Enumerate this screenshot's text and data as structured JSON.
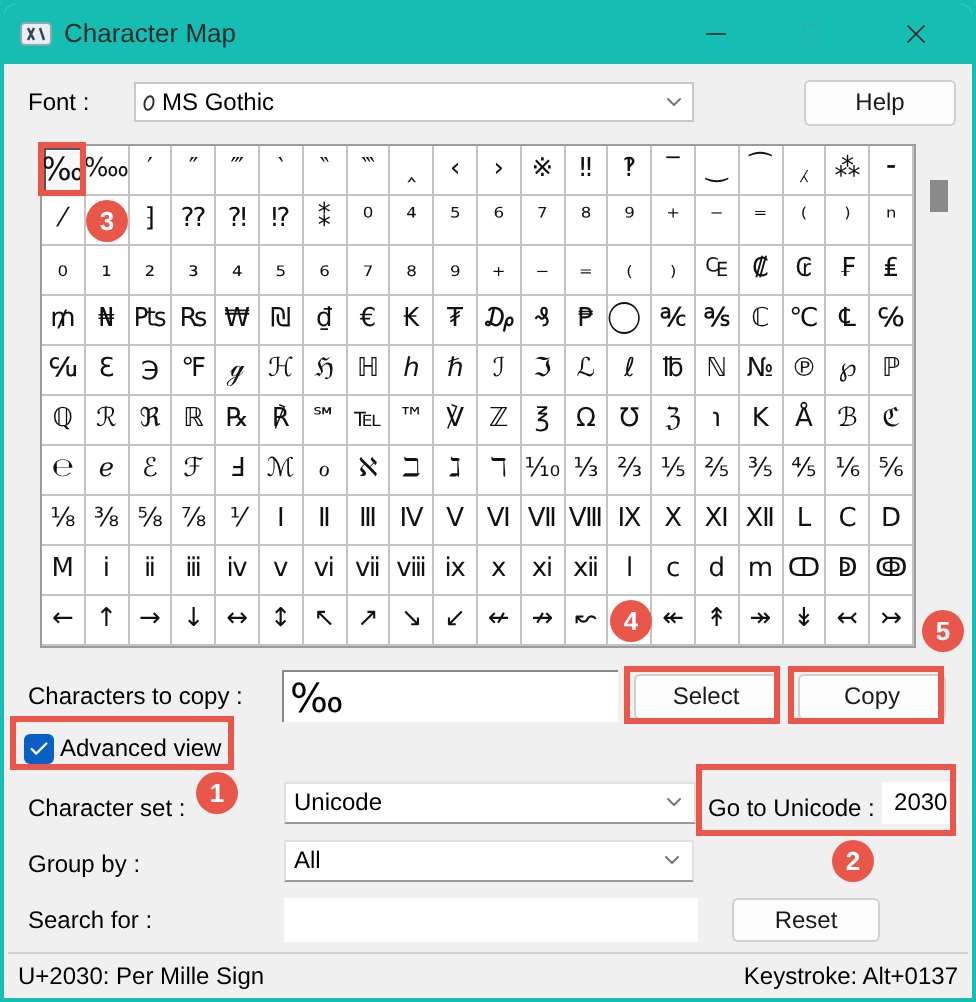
{
  "window": {
    "title": "Character Map"
  },
  "font": {
    "label": "Font :",
    "value": "MS Gothic"
  },
  "help_button": "Help",
  "grid": [
    {
      "cells": [
        {
          "char": "‰",
          "selected": true
        },
        {
          "char": "‱",
          "selected": false
        },
        {
          "char": "′",
          "selected": false
        },
        {
          "char": "″",
          "selected": false
        },
        {
          "char": "‴",
          "selected": false
        },
        {
          "char": "‵",
          "selected": false
        },
        {
          "char": "‶",
          "selected": false
        },
        {
          "char": "‷",
          "selected": false
        },
        {
          "char": "‸",
          "selected": false
        },
        {
          "char": "‹",
          "selected": false
        },
        {
          "char": "›",
          "selected": false
        },
        {
          "char": "※",
          "selected": false
        },
        {
          "char": "‼",
          "selected": false
        },
        {
          "char": "‽",
          "selected": false
        },
        {
          "char": "‾",
          "selected": false
        },
        {
          "char": "‿",
          "selected": false
        },
        {
          "char": "⁀",
          "selected": false
        },
        {
          "char": "⁁",
          "selected": false
        },
        {
          "char": "⁂",
          "selected": false
        },
        {
          "char": "⁃",
          "selected": false
        }
      ]
    },
    {
      "cells": [
        {
          "char": "⁄",
          "selected": false
        },
        {
          "kind": "covered"
        },
        {
          "char": "⁆",
          "selected": false
        },
        {
          "char": "⁇",
          "selected": false
        },
        {
          "char": "⁈",
          "selected": false
        },
        {
          "char": "⁉",
          "selected": false
        },
        {
          "char": "⁑",
          "selected": false
        },
        {
          "char": "⁰",
          "selected": false
        },
        {
          "char": "⁴",
          "selected": false
        },
        {
          "char": "⁵",
          "selected": false
        },
        {
          "char": "⁶",
          "selected": false
        },
        {
          "char": "⁷",
          "selected": false
        },
        {
          "char": "⁸",
          "selected": false
        },
        {
          "char": "⁹",
          "selected": false
        },
        {
          "char": "⁺",
          "selected": false
        },
        {
          "char": "⁻",
          "selected": false
        },
        {
          "char": "⁼",
          "selected": false
        },
        {
          "char": "⁽",
          "selected": false
        },
        {
          "char": "⁾",
          "selected": false
        },
        {
          "char": "ⁿ",
          "selected": false
        }
      ]
    },
    {
      "cells": [
        {
          "char": "₀",
          "selected": false
        },
        {
          "char": "₁",
          "selected": false
        },
        {
          "char": "₂",
          "selected": false
        },
        {
          "char": "₃",
          "selected": false
        },
        {
          "char": "₄",
          "selected": false
        },
        {
          "char": "₅",
          "selected": false
        },
        {
          "char": "₆",
          "selected": false
        },
        {
          "char": "₇",
          "selected": false
        },
        {
          "char": "₈",
          "selected": false
        },
        {
          "char": "₉",
          "selected": false
        },
        {
          "char": "₊",
          "selected": false
        },
        {
          "char": "₋",
          "selected": false
        },
        {
          "char": "₌",
          "selected": false
        },
        {
          "char": "₍",
          "selected": false
        },
        {
          "char": "₎",
          "selected": false
        },
        {
          "char": "₠",
          "selected": false
        },
        {
          "char": "₡",
          "selected": false
        },
        {
          "char": "₢",
          "selected": false
        },
        {
          "char": "₣",
          "selected": false
        },
        {
          "char": "₤",
          "selected": false
        }
      ]
    },
    {
      "cells": [
        {
          "char": "₥",
          "selected": false
        },
        {
          "char": "₦",
          "selected": false
        },
        {
          "char": "₧",
          "selected": false
        },
        {
          "char": "₨",
          "selected": false
        },
        {
          "char": "₩",
          "selected": false
        },
        {
          "char": "₪",
          "selected": false
        },
        {
          "char": "₫",
          "selected": false
        },
        {
          "char": "€",
          "selected": false
        },
        {
          "char": "₭",
          "selected": false
        },
        {
          "char": "₮",
          "selected": false
        },
        {
          "char": "₯",
          "selected": false
        },
        {
          "char": "₰",
          "selected": false
        },
        {
          "char": "₱",
          "selected": false
        },
        {
          "char": "⃝",
          "selected": false
        },
        {
          "char": "℀",
          "selected": false
        },
        {
          "char": "℁",
          "selected": false
        },
        {
          "char": "ℂ",
          "selected": false
        },
        {
          "char": "℃",
          "selected": false
        },
        {
          "char": "℄",
          "selected": false
        },
        {
          "char": "℅",
          "selected": false
        }
      ]
    },
    {
      "cells": [
        {
          "char": "℆",
          "selected": false
        },
        {
          "char": "ℇ",
          "selected": false
        },
        {
          "char": "℈",
          "selected": false
        },
        {
          "char": "℉",
          "selected": false
        },
        {
          "char": "ℊ",
          "selected": false
        },
        {
          "char": "ℋ",
          "selected": false
        },
        {
          "char": "ℌ",
          "selected": false
        },
        {
          "char": "ℍ",
          "selected": false
        },
        {
          "char": "ℎ",
          "selected": false
        },
        {
          "char": "ℏ",
          "selected": false
        },
        {
          "char": "ℐ",
          "selected": false
        },
        {
          "char": "ℑ",
          "selected": false
        },
        {
          "char": "ℒ",
          "selected": false
        },
        {
          "char": "ℓ",
          "selected": false
        },
        {
          "char": "℔",
          "selected": false
        },
        {
          "char": "ℕ",
          "selected": false
        },
        {
          "char": "№",
          "selected": false
        },
        {
          "char": "℗",
          "selected": false
        },
        {
          "char": "℘",
          "selected": false
        },
        {
          "char": "ℙ",
          "selected": false
        }
      ]
    },
    {
      "cells": [
        {
          "char": "ℚ",
          "selected": false
        },
        {
          "char": "ℛ",
          "selected": false
        },
        {
          "char": "ℜ",
          "selected": false
        },
        {
          "char": "ℝ",
          "selected": false
        },
        {
          "char": "℞",
          "selected": false
        },
        {
          "char": "℟",
          "selected": false
        },
        {
          "char": "℠",
          "selected": false
        },
        {
          "char": "℡",
          "selected": false
        },
        {
          "char": "™",
          "selected": false
        },
        {
          "char": "℣",
          "selected": false
        },
        {
          "char": "ℤ",
          "selected": false
        },
        {
          "char": "℥",
          "selected": false
        },
        {
          "char": "Ω",
          "selected": false
        },
        {
          "char": "℧",
          "selected": false
        },
        {
          "char": "ℨ",
          "selected": false
        },
        {
          "char": "℩",
          "selected": false
        },
        {
          "char": "K",
          "selected": false
        },
        {
          "char": "Å",
          "selected": false
        },
        {
          "char": "ℬ",
          "selected": false
        },
        {
          "char": "ℭ",
          "selected": false
        }
      ]
    },
    {
      "cells": [
        {
          "char": "℮",
          "selected": false
        },
        {
          "char": "ℯ",
          "selected": false
        },
        {
          "char": "ℰ",
          "selected": false
        },
        {
          "char": "ℱ",
          "selected": false
        },
        {
          "char": "Ⅎ",
          "selected": false
        },
        {
          "char": "ℳ",
          "selected": false
        },
        {
          "char": "ℴ",
          "selected": false
        },
        {
          "char": "ℵ",
          "selected": false
        },
        {
          "char": "ℶ",
          "selected": false
        },
        {
          "char": "ℷ",
          "selected": false
        },
        {
          "char": "ℸ",
          "selected": false
        },
        {
          "char": "⅒",
          "selected": false
        },
        {
          "char": "⅓",
          "selected": false
        },
        {
          "char": "⅔",
          "selected": false
        },
        {
          "char": "⅕",
          "selected": false
        },
        {
          "char": "⅖",
          "selected": false
        },
        {
          "char": "⅗",
          "selected": false
        },
        {
          "char": "⅘",
          "selected": false
        },
        {
          "char": "⅙",
          "selected": false
        },
        {
          "char": "⅚",
          "selected": false
        }
      ]
    },
    {
      "cells": [
        {
          "char": "⅛",
          "selected": false
        },
        {
          "char": "⅜",
          "selected": false
        },
        {
          "char": "⅝",
          "selected": false
        },
        {
          "char": "⅞",
          "selected": false
        },
        {
          "char": "⅟",
          "selected": false
        },
        {
          "char": "Ⅰ",
          "selected": false
        },
        {
          "char": "Ⅱ",
          "selected": false
        },
        {
          "char": "Ⅲ",
          "selected": false
        },
        {
          "char": "Ⅳ",
          "selected": false
        },
        {
          "char": "Ⅴ",
          "selected": false
        },
        {
          "char": "Ⅵ",
          "selected": false
        },
        {
          "char": "Ⅶ",
          "selected": false
        },
        {
          "char": "Ⅷ",
          "selected": false
        },
        {
          "char": "Ⅸ",
          "selected": false
        },
        {
          "char": "Ⅹ",
          "selected": false
        },
        {
          "char": "Ⅺ",
          "selected": false
        },
        {
          "char": "Ⅻ",
          "selected": false
        },
        {
          "char": "Ⅼ",
          "selected": false
        },
        {
          "char": "Ⅽ",
          "selected": false
        },
        {
          "char": "Ⅾ",
          "selected": false
        }
      ]
    },
    {
      "cells": [
        {
          "char": "Ⅿ",
          "selected": false
        },
        {
          "char": "ⅰ",
          "selected": false
        },
        {
          "char": "ⅱ",
          "selected": false
        },
        {
          "char": "ⅲ",
          "selected": false
        },
        {
          "char": "ⅳ",
          "selected": false
        },
        {
          "char": "ⅴ",
          "selected": false
        },
        {
          "char": "ⅵ",
          "selected": false
        },
        {
          "char": "ⅶ",
          "selected": false
        },
        {
          "char": "ⅷ",
          "selected": false
        },
        {
          "char": "ⅸ",
          "selected": false
        },
        {
          "char": "ⅹ",
          "selected": false
        },
        {
          "char": "ⅺ",
          "selected": false
        },
        {
          "char": "ⅻ",
          "selected": false
        },
        {
          "char": "ⅼ",
          "selected": false
        },
        {
          "char": "ⅽ",
          "selected": false
        },
        {
          "char": "ⅾ",
          "selected": false
        },
        {
          "char": "ⅿ",
          "selected": false
        },
        {
          "char": "ↀ",
          "selected": false
        },
        {
          "char": "ↁ",
          "selected": false
        },
        {
          "char": "ↂ",
          "selected": false
        }
      ]
    },
    {
      "cells": [
        {
          "char": "←",
          "selected": false
        },
        {
          "char": "↑",
          "selected": false
        },
        {
          "char": "→",
          "selected": false
        },
        {
          "char": "↓",
          "selected": false
        },
        {
          "char": "↔",
          "selected": false
        },
        {
          "char": "↕",
          "selected": false
        },
        {
          "char": "↖",
          "selected": false
        },
        {
          "char": "↗",
          "selected": false
        },
        {
          "char": "↘",
          "selected": false
        },
        {
          "char": "↙",
          "selected": false
        },
        {
          "char": "↚",
          "selected": false
        },
        {
          "char": "↛",
          "selected": false
        },
        {
          "char": "↜",
          "selected": false
        },
        {
          "kind": "covered"
        },
        {
          "char": "↞",
          "selected": false
        },
        {
          "char": "↟",
          "selected": false
        },
        {
          "char": "↠",
          "selected": false
        },
        {
          "char": "↡",
          "selected": false
        },
        {
          "char": "↢",
          "selected": false
        },
        {
          "char": "↣",
          "selected": false
        }
      ]
    }
  ],
  "characters_to_copy": {
    "label": "Characters to copy :",
    "value": "‰"
  },
  "select_button": "Select",
  "copy_button": "Copy",
  "advanced_view": {
    "label": "Advanced view",
    "checked": true
  },
  "character_set": {
    "label": "Character set :",
    "value": "Unicode"
  },
  "go_to_unicode": {
    "label": "Go to Unicode :",
    "value": "2030"
  },
  "group_by": {
    "label": "Group by :",
    "value": "All"
  },
  "search_for": {
    "label": "Search for :"
  },
  "reset_button": "Reset",
  "status_bar": {
    "character": "U+2030: Per Mille Sign",
    "keystroke": "Keystroke: Alt+0137"
  },
  "callouts": [
    {
      "label": "3"
    },
    {
      "label": "4"
    },
    {
      "label": "5"
    },
    {
      "label": "1"
    },
    {
      "label": "2"
    }
  ]
}
